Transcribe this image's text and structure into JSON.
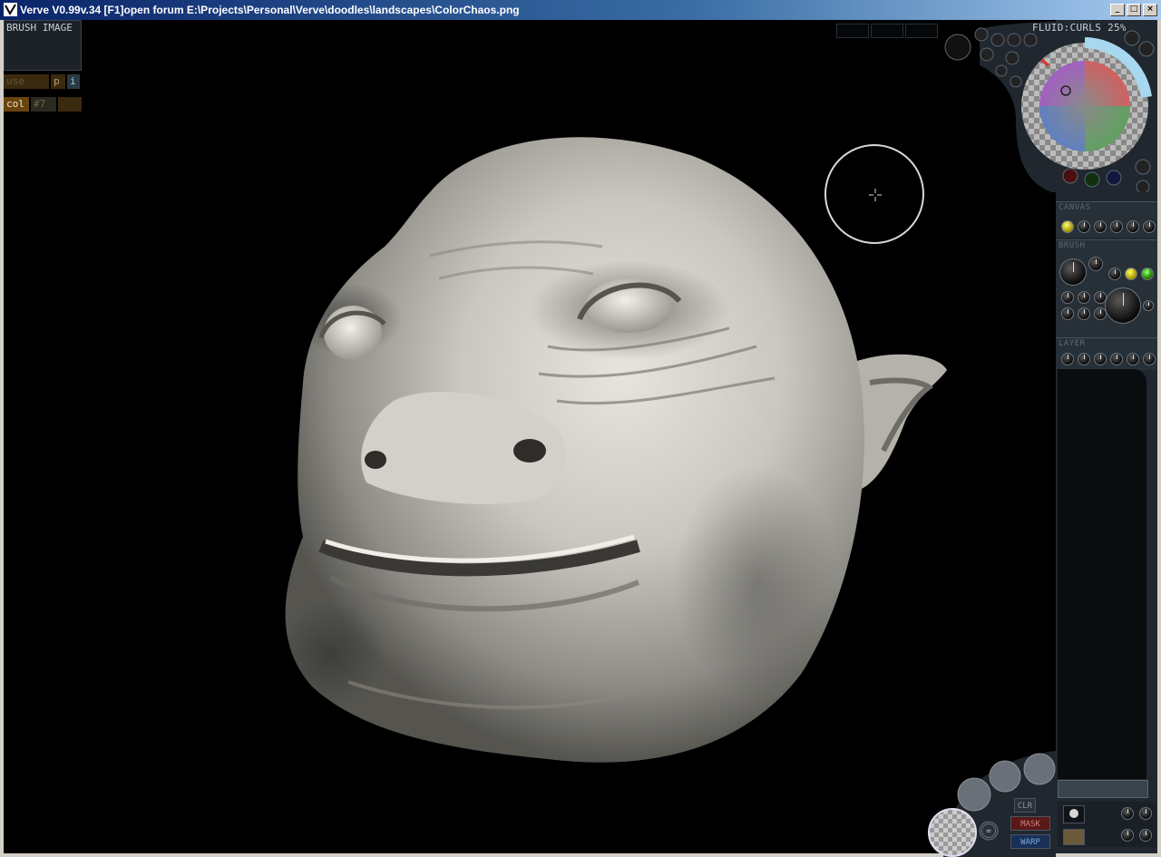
{
  "window": {
    "title": "Verve V0.99v.34 [F1]open forum  E:\\Projects\\Personal\\Verve\\doodles\\landscapes\\ColorChaos.png",
    "minimize": "_",
    "maximize": "□",
    "close": "×"
  },
  "left_panel": {
    "brush_image_label": "BRUSH IMAGE",
    "use_label": "use",
    "p_label": "p",
    "i_label": "i",
    "col_label": "col",
    "ratio_label": "#7"
  },
  "color_panel": {
    "fluid_label": "FLUID:CURLS 25%",
    "accent_color": "#e03030",
    "wheel_highlight": "#a8d8f0"
  },
  "right_panel": {
    "canvas_label": "CANVAS",
    "brush_label": "BRUSH",
    "layer_label": "LAYER"
  },
  "bottom_tools": {
    "clr_label": "CLR",
    "mask_label": "MASK",
    "warp_label": "WARP",
    "eq_label": "="
  },
  "icons": [
    "verve-app-icon",
    "brush-cursor-icon",
    "color-wheel-icon",
    "knob-icon",
    "fluid-tool-icon"
  ]
}
